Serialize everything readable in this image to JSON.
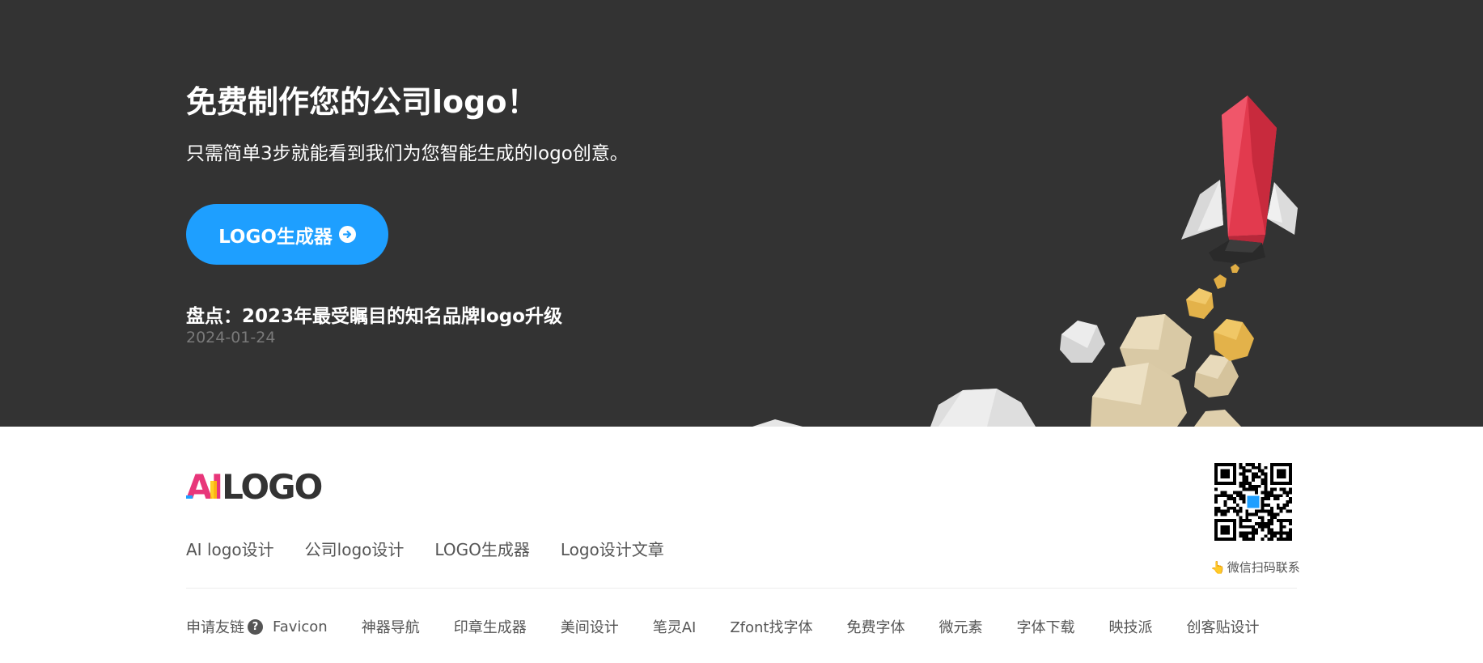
{
  "hero": {
    "title": "免费制作您的公司logo！",
    "subtitle": "只需简单3步就能看到我们为您智能生成的logo创意。",
    "cta_label": "LOGO生成器",
    "article_title": "盘点：2023年最受瞩目的知名品牌logo升级",
    "article_date": "2024-01-24",
    "background_color": "#333333",
    "cta_color": "#1e9fff"
  },
  "footer": {
    "logo": {
      "part_ai": "AI",
      "part_logo": "LOGO"
    },
    "nav": [
      "AI logo设计",
      "公司logo设计",
      "LOGO生成器",
      "Logo设计文章"
    ],
    "apply_link_label": "申请友链",
    "friend_links": [
      "Favicon",
      "神器导航",
      "印章生成器",
      "美间设计",
      "笔灵AI",
      "Zfont找字体",
      "免费字体",
      "微元素",
      "字体下载",
      "映技派",
      "创客贴设计"
    ],
    "qr_caption": "微信扫码联系",
    "qr_icon": "pointing-hand-icon"
  }
}
